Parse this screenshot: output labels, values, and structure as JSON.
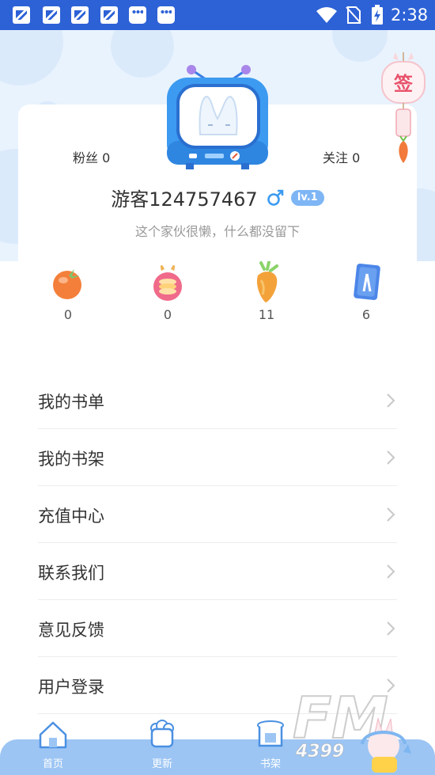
{
  "status_bar": {
    "time": "2:38",
    "notification_icons": [
      "app-notification-icon",
      "app-notification-icon",
      "app-notification-icon",
      "app-notification-icon",
      "bag-notification-icon",
      "bag-notification-icon"
    ],
    "right_icons": [
      "wifi-icon",
      "no-sim-icon",
      "battery-charging-icon"
    ]
  },
  "profile": {
    "followers_text": "粉丝 0",
    "following_text": "关注 0",
    "username": "游客124757467",
    "gender_icon": "male-icon",
    "level": "lv.1",
    "bio": "这个家伙很懒，什么都没留下",
    "signin_label": "签"
  },
  "stats": [
    {
      "icon": "tomato-icon",
      "value": "0"
    },
    {
      "icon": "coin-stack-icon",
      "value": "0"
    },
    {
      "icon": "carrot-icon",
      "value": "11"
    },
    {
      "icon": "carrot-card-icon",
      "value": "6"
    }
  ],
  "menu": [
    {
      "label": "我的书单"
    },
    {
      "label": "我的书架"
    },
    {
      "label": "充值中心"
    },
    {
      "label": "联系我们"
    },
    {
      "label": "意见反馈"
    },
    {
      "label": "用户登录"
    }
  ],
  "bottom_nav": [
    {
      "label": "首页",
      "icon": "home-icon"
    },
    {
      "label": "更新",
      "icon": "update-icon"
    },
    {
      "label": "书架",
      "icon": "bookshelf-icon"
    }
  ],
  "watermark": {
    "text": "4399",
    "logo": "FM"
  },
  "colors": {
    "status_bar": "#2d61d6",
    "header_bg": "#e9f3fd",
    "accent_blue": "#3c9bf0",
    "nav_bg": "#9cc5f4",
    "text_primary": "#333333",
    "text_secondary": "#999999"
  }
}
